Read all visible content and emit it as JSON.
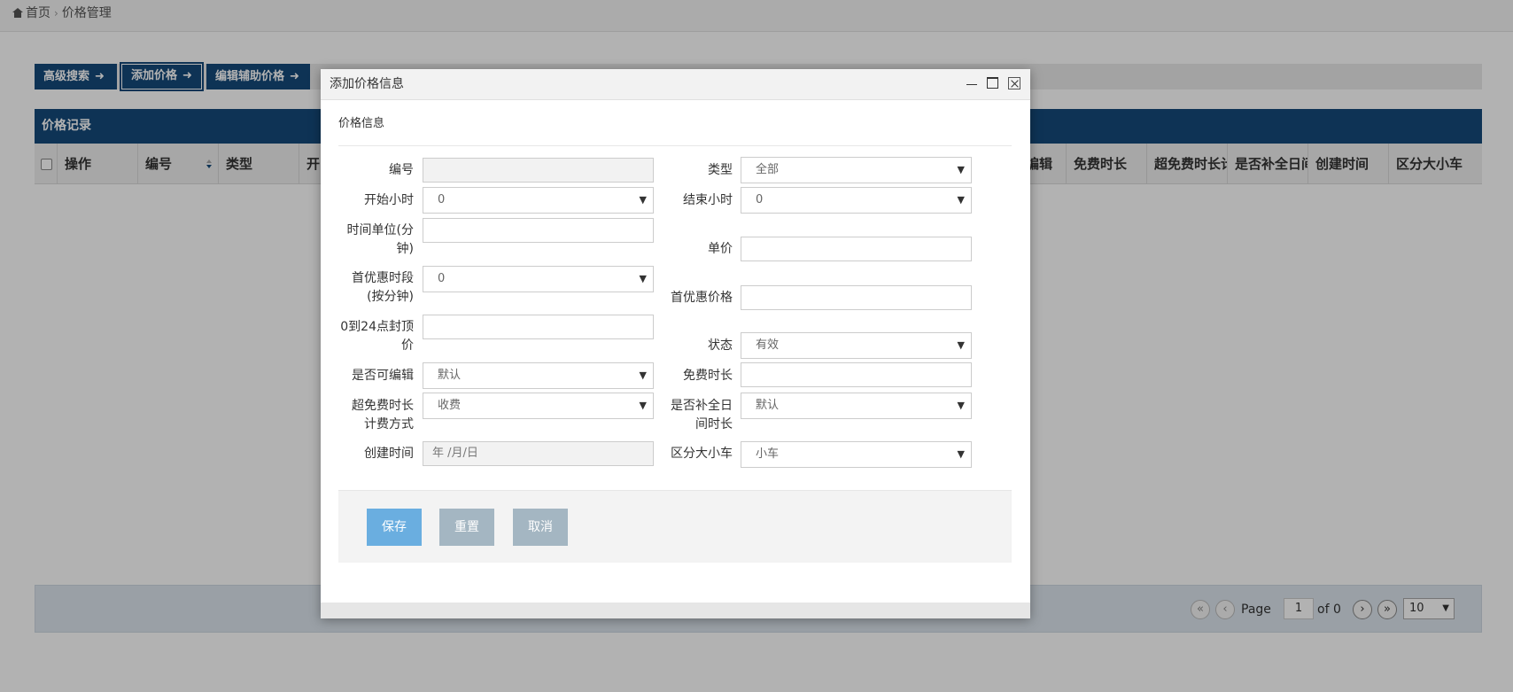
{
  "breadcrumb": {
    "home": "首页",
    "separator": "›",
    "current": "价格管理"
  },
  "toolbar": {
    "buttons": [
      {
        "label": "高级搜索",
        "arrow": "➜"
      },
      {
        "label": "添加价格",
        "arrow": "➜"
      },
      {
        "label": "编辑辅助价格",
        "arrow": "➜"
      }
    ]
  },
  "grid": {
    "title": "价格记录",
    "columns": [
      "操作",
      "编号",
      "类型",
      "开",
      "编辑",
      "免费时长",
      "超免费时长计",
      "是否补全日间",
      "创建时间",
      "区分大小车"
    ]
  },
  "pager": {
    "page_label": "Page",
    "page_value": "1",
    "of_label": "of 0",
    "page_size": "10",
    "first": "«",
    "prev": "‹",
    "next": "›",
    "last": "»"
  },
  "modal": {
    "title": "添加价格信息",
    "section": "价格信息",
    "fields": {
      "code": {
        "label": "编号",
        "value": ""
      },
      "type": {
        "label": "类型",
        "value": "全部"
      },
      "start_hour": {
        "label": "开始小时",
        "value": "0"
      },
      "end_hour": {
        "label": "结束小时",
        "value": "0"
      },
      "time_unit": {
        "label_line1": "时间单位(分",
        "label_line2": "钟)",
        "value": ""
      },
      "unit_price": {
        "label": "单价",
        "value": ""
      },
      "first_discount_period": {
        "label_line1": "首优惠时段",
        "label_line2": "(按分钟)",
        "value": "0"
      },
      "first_discount_price": {
        "label": "首优惠价格",
        "value": ""
      },
      "cap_price": {
        "label_line1": "0到24点封顶",
        "label_line2": "价",
        "value": ""
      },
      "status": {
        "label": "状态",
        "value": "有效"
      },
      "editable": {
        "label": "是否可编辑",
        "value": "默认"
      },
      "free_duration": {
        "label": "免费时长",
        "value": ""
      },
      "overtime_billing": {
        "label_line1": "超免费时长",
        "label_line2": "计费方式",
        "value": "收费"
      },
      "fill_daytime": {
        "label_line1": "是否补全日",
        "label_line2": "间时长",
        "value": "默认"
      },
      "created_time": {
        "label": "创建时间",
        "placeholder": "年 /月/日"
      },
      "vehicle_size": {
        "label": "区分大小车",
        "value": "小车"
      }
    },
    "buttons": {
      "save": "保存",
      "reset": "重置",
      "cancel": "取消"
    }
  }
}
